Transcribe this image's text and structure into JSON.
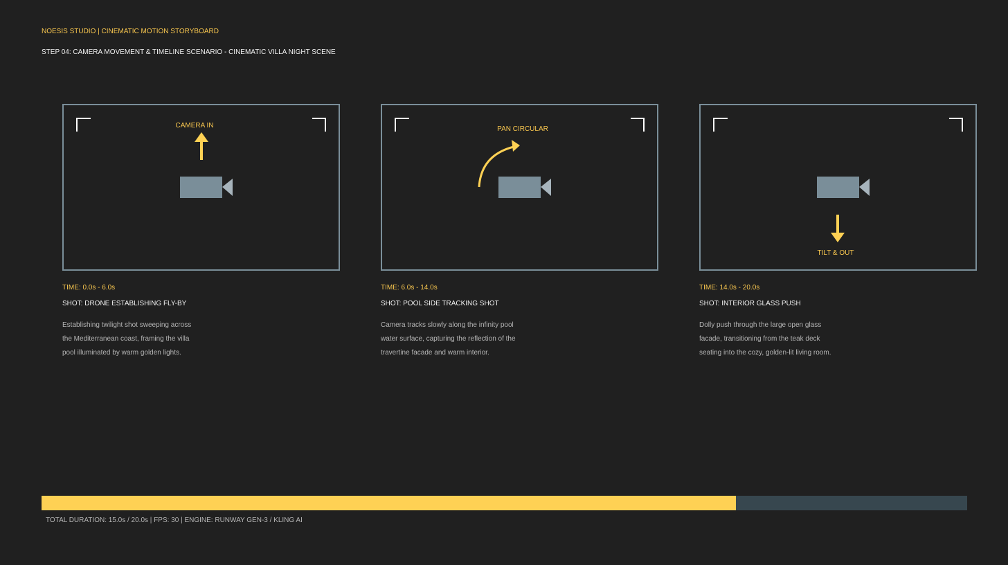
{
  "header": {
    "title": "NOESIS STUDIO | CINEMATIC MOTION STORYBOARD",
    "subtitle": "STEP 04: CAMERA MOVEMENT & TIMELINE SCENARIO - CINEMATIC VILLA NIGHT SCENE"
  },
  "colors": {
    "background": "#202020",
    "accent": "#fed154",
    "frame_border": "#7a8e99",
    "camera": "#7a8e99",
    "timeline_track": "#37474f"
  },
  "shots": [
    {
      "movement_label": "CAMERA IN",
      "movement_icon": "arrow-up-icon",
      "time": "TIME: 0.0s - 6.0s",
      "name": "SHOT: DRONE ESTABLISHING FLY-BY",
      "description": "Establishing twilight shot sweeping across the Mediterranean coast, framing the villa pool illuminated by warm golden lights."
    },
    {
      "movement_label": "PAN CIRCULAR",
      "movement_icon": "curved-arrow-icon",
      "time": "TIME: 6.0s - 14.0s",
      "name": "SHOT: POOL SIDE TRACKING SHOT",
      "description": "Camera tracks slowly along the infinity pool water surface, capturing the reflection of the travertine facade and warm interior."
    },
    {
      "movement_label": "TILT & OUT",
      "movement_icon": "arrow-down-icon",
      "time": "TIME: 14.0s - 20.0s",
      "name": "SHOT: INTERIOR GLASS PUSH",
      "description": "Dolly push through the large open glass facade, transitioning from the teak deck seating into the cozy, golden-lit living room."
    }
  ],
  "timeline": {
    "elapsed_seconds": 15.0,
    "total_seconds": 20.0,
    "progress_fraction": 0.75,
    "footer": "TOTAL DURATION: 15.0s / 20.0s | FPS: 30 | ENGINE: RUNWAY GEN-3 / KLING AI"
  }
}
